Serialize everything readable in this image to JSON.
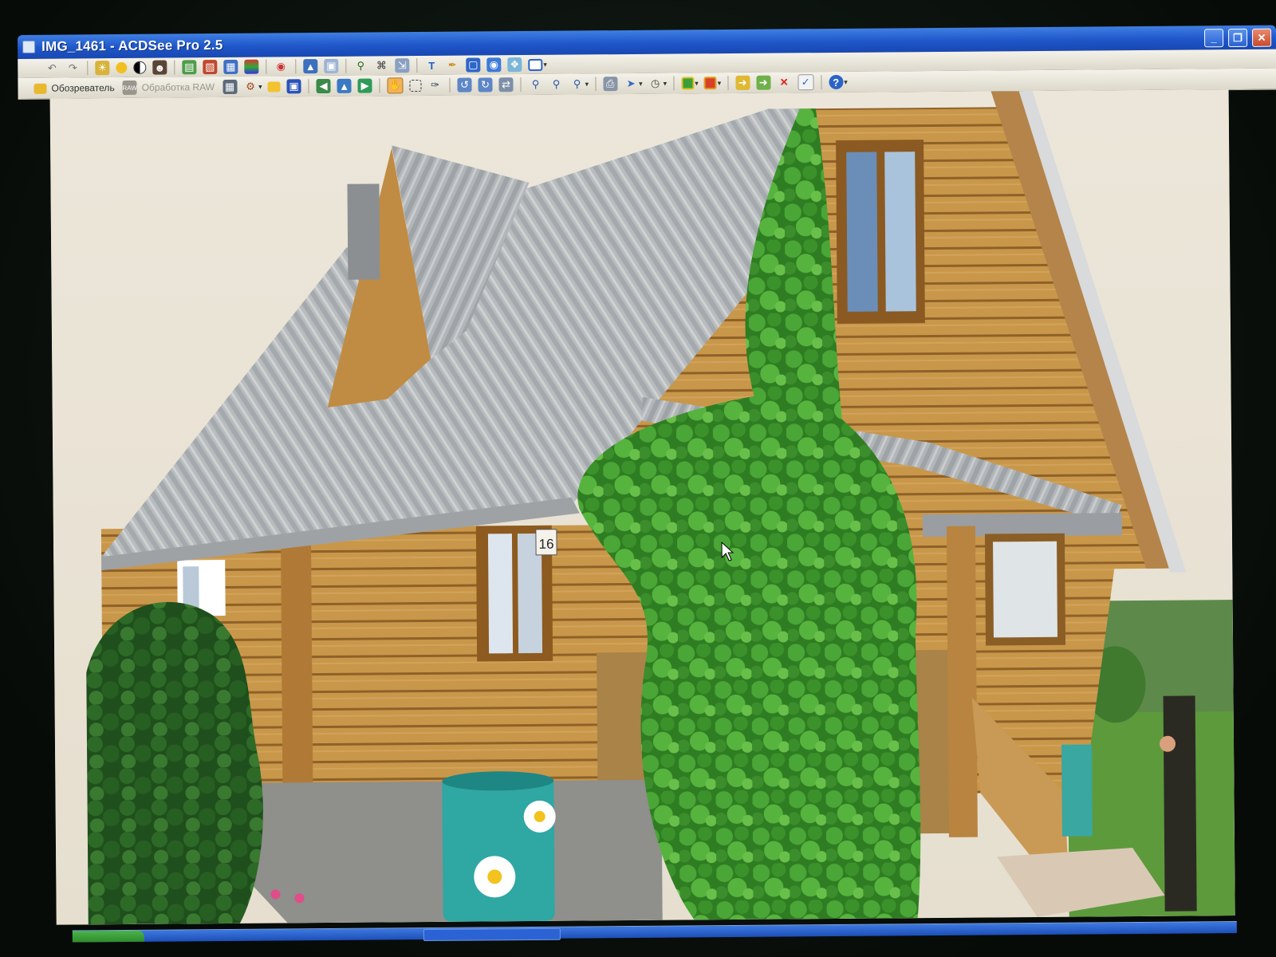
{
  "window": {
    "title": "IMG_1461 - ACDSee Pro 2.5",
    "controls": {
      "minimize": "_",
      "maximize": "❐",
      "close": "✕"
    }
  },
  "toolbar": {
    "browse_label": "Обозреватель",
    "raw_label": "Обработка RAW"
  },
  "photo": {
    "house_number": "16"
  },
  "colors": {
    "titlebar": "#1f56c9",
    "toolbar": "#e8e5da",
    "wood": "#c79a4e",
    "roof": "#b9bcbf",
    "ivy": "#3f9a2c",
    "sky": "#ece5d6",
    "barrel": "#2fa7a3"
  }
}
